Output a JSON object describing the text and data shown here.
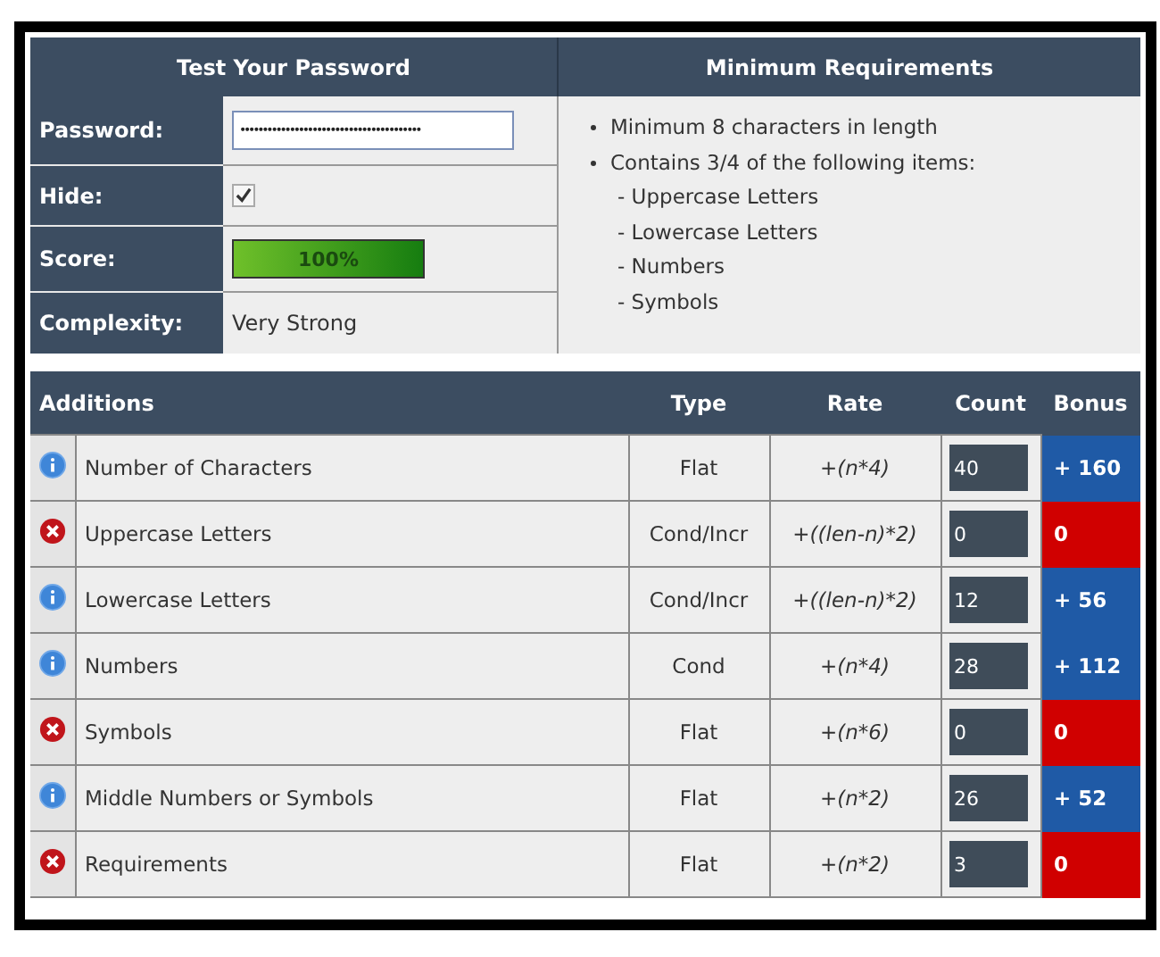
{
  "test_panel": {
    "title": "Test Your Password",
    "password": {
      "label": "Password:",
      "value": "••••••••••••••••••••••••••••••••••••••••"
    },
    "hide": {
      "label": "Hide:",
      "checked": true
    },
    "score": {
      "label": "Score:",
      "level": 1,
      "reading": "100%"
    },
    "complexity": {
      "label": "Complexity:",
      "value": "Very Strong"
    }
  },
  "requirements_panel": {
    "title": "Minimum Requirements",
    "items": [
      {
        "text": "Minimum 8 characters in length"
      },
      {
        "text": "Contains 3/4 of the following items:",
        "children": [
          {
            "text": "- Uppercase Letters"
          },
          {
            "text": "- Lowercase Letters"
          },
          {
            "text": "- Numbers"
          },
          {
            "text": "- Symbols"
          }
        ]
      }
    ]
  },
  "additions": {
    "columns": [
      "Additions",
      "Type",
      "Rate",
      "Count",
      "Bonus"
    ],
    "rows": [
      {
        "kind": "pass",
        "name": "Number of Characters",
        "type": "Flat",
        "rate": "+(n*4)",
        "count": "40",
        "bonus": "+ 160"
      },
      {
        "kind": "fail",
        "name": "Uppercase Letters",
        "type": "Cond/Incr",
        "rate": "+((len-n)*2)",
        "count": "0",
        "bonus": "0"
      },
      {
        "kind": "pass",
        "name": "Lowercase Letters",
        "type": "Cond/Incr",
        "rate": "+((len-n)*2)",
        "count": "12",
        "bonus": "+ 56"
      },
      {
        "kind": "pass",
        "name": "Numbers",
        "type": "Cond",
        "rate": "+(n*4)",
        "count": "28",
        "bonus": "+ 112"
      },
      {
        "kind": "fail",
        "name": "Symbols",
        "type": "Flat",
        "rate": "+(n*6)",
        "count": "0",
        "bonus": "0"
      },
      {
        "kind": "pass",
        "name": "Middle Numbers or Symbols",
        "type": "Flat",
        "rate": "+(n*2)",
        "count": "26",
        "bonus": "+ 52"
      },
      {
        "kind": "fail",
        "name": "Requirements",
        "type": "Flat",
        "rate": "+(n*2)",
        "count": "3",
        "bonus": "0"
      }
    ]
  }
}
